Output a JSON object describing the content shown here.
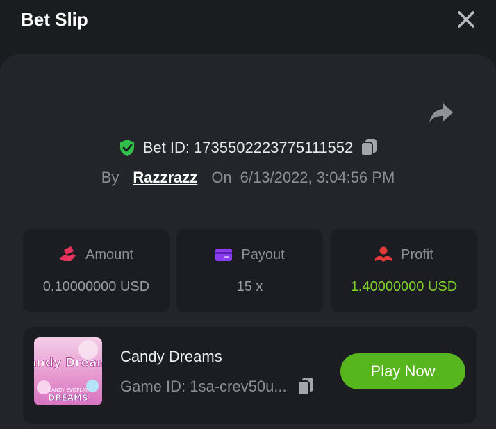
{
  "header": {
    "title": "Bet Slip"
  },
  "bet": {
    "id_label": "Bet ID: 1735502223775111552",
    "by_label": "By",
    "username": "Razzrazz",
    "on_label": "On",
    "datetime": "6/13/2022, 3:04:56 PM"
  },
  "stats": [
    {
      "label": "Amount",
      "value": "0.10000000 USD",
      "icon": "money-hand-icon",
      "color": "#e8345c"
    },
    {
      "label": "Payout",
      "value": "15 x",
      "icon": "card-icon",
      "color": "#8a3df0"
    },
    {
      "label": "Profit",
      "value": "1.40000000 USD",
      "icon": "profit-hand-icon",
      "color": "#e63a3a"
    }
  ],
  "game": {
    "name": "Candy Dreams",
    "id_label": "Game ID: 1sa-crev50u...",
    "thumb_title": "Candy Dreams",
    "thumb_brand": "CANDY EVOPLAY",
    "thumb_bottom": "DREAMS",
    "play_label": "Play Now"
  },
  "colors": {
    "accent_green": "#57b51e",
    "profit_green": "#7fd12a",
    "shield_green": "#2fbf4a"
  }
}
